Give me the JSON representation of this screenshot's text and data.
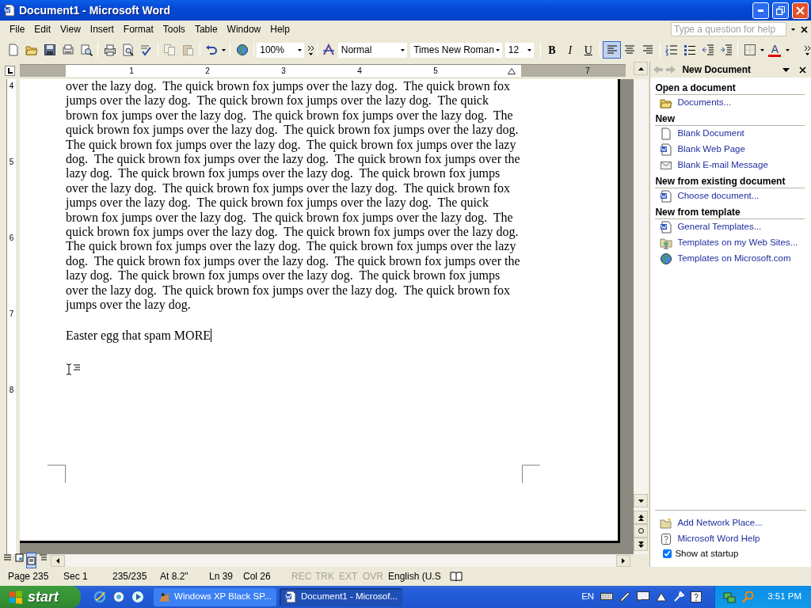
{
  "window": {
    "title": "Document1 - Microsoft Word"
  },
  "menu": [
    "File",
    "Edit",
    "View",
    "Insert",
    "Format",
    "Tools",
    "Table",
    "Window",
    "Help"
  ],
  "help_box": {
    "placeholder": "Type a question for help"
  },
  "toolbar": {
    "copy": {
      "disabled": true
    },
    "paste": {
      "disabled": true
    },
    "zoom": "100%",
    "style": "Normal",
    "font": "Times New Roman",
    "size": "12",
    "bold": "B",
    "italic": "I",
    "underline": "U",
    "alignment": [
      {
        "selected": true
      },
      {
        "selected": false
      },
      {
        "selected": false
      }
    ],
    "font_color": "A"
  },
  "ruler": [
    {
      "kind": "number",
      "label": "1"
    },
    {
      "kind": "number",
      "label": "2"
    },
    {
      "kind": "number",
      "label": "3"
    },
    {
      "kind": "number",
      "label": "4"
    },
    {
      "kind": "number",
      "label": "5"
    },
    {
      "kind": "indent-marker"
    },
    {
      "kind": "number",
      "label": "7"
    }
  ],
  "vertical_ruler": [
    "4",
    "5",
    "6",
    "7",
    "8"
  ],
  "document": {
    "paragraph_lines": [
      "over the lazy dog.  The quick brown fox jumps over the lazy dog.  The quick brown fox",
      "jumps over the lazy dog.  The quick brown fox jumps over the lazy dog.  The quick",
      "brown fox jumps over the lazy dog.  The quick brown fox jumps over the lazy dog.  The",
      "quick brown fox jumps over the lazy dog.  The quick brown fox jumps over the lazy dog.",
      "The quick brown fox jumps over the lazy dog.  The quick brown fox jumps over the lazy",
      "dog.  The quick brown fox jumps over the lazy dog.  The quick brown fox jumps over the",
      "lazy dog.  The quick brown fox jumps over the lazy dog.  The quick brown fox jumps",
      "over the lazy dog.  The quick brown fox jumps over the lazy dog.  The quick brown fox",
      "jumps over the lazy dog.  The quick brown fox jumps over the lazy dog.  The quick",
      "brown fox jumps over the lazy dog.  The quick brown fox jumps over the lazy dog.  The",
      "quick brown fox jumps over the lazy dog.  The quick brown fox jumps over the lazy dog.",
      "The quick brown fox jumps over the lazy dog.  The quick brown fox jumps over the lazy",
      "dog.  The quick brown fox jumps over the lazy dog.  The quick brown fox jumps over the",
      "lazy dog.  The quick brown fox jumps over the lazy dog.  The quick brown fox jumps",
      "over the lazy dog.  The quick brown fox jumps over the lazy dog.  The quick brown fox",
      "jumps over the lazy dog."
    ],
    "typed_line": "Easter egg that spam MORE"
  },
  "task_pane": {
    "title": "New Document",
    "sections": [
      {
        "heading": "Open a document",
        "links": [
          "Documents..."
        ]
      },
      {
        "heading": "New",
        "links": [
          "Blank Document",
          "Blank Web Page",
          "Blank E-mail Message"
        ]
      },
      {
        "heading": "New from existing document",
        "links": [
          "Choose document..."
        ]
      },
      {
        "heading": "New from template",
        "links": [
          "General Templates...",
          "Templates on my Web Sites...",
          "Templates on Microsoft.com"
        ]
      }
    ],
    "footer_links": [
      "Add Network Place...",
      "Microsoft Word Help"
    ],
    "show_at_startup": {
      "label": "Show at startup",
      "checked": true
    }
  },
  "status_bar": {
    "fields": [
      "Page 235",
      "Sec 1",
      "235/235",
      "At 8.2\"",
      "Ln 39",
      "Col 26"
    ],
    "modes": [
      {
        "label": "REC",
        "active": false
      },
      {
        "label": "TRK",
        "active": false
      },
      {
        "label": "EXT",
        "active": false
      },
      {
        "label": "OVR",
        "active": false
      }
    ],
    "language": "English (U.S"
  },
  "taskbar": {
    "start": "start",
    "tasks": [
      {
        "label": "Windows XP Black SP...",
        "selected": false
      },
      {
        "label": "Document1 - Microsof...",
        "selected": true
      }
    ],
    "language": "EN",
    "clock": "3:51 PM"
  }
}
